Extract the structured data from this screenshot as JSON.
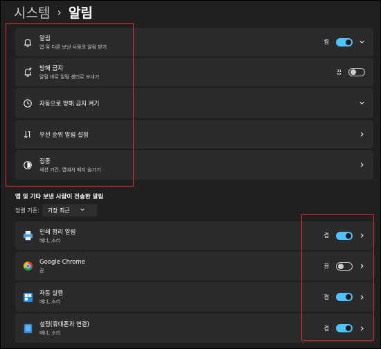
{
  "breadcrumb": {
    "parent": "시스템",
    "separator": "›",
    "current": "알림"
  },
  "settings": [
    {
      "title": "알림",
      "subtitle": "앱 및 다른 보낸 사람의 알림 받기",
      "state": "켬",
      "toggle": "on",
      "chevron": "down",
      "icon": "bell-icon"
    },
    {
      "title": "방해 금지",
      "subtitle": "알림 바로 알림 센터로 보내기",
      "state": "끔",
      "toggle": "off",
      "chevron": "",
      "icon": "bell-snooze-icon"
    },
    {
      "title": "자동으로 방해 금지 켜기",
      "subtitle": "",
      "state": "",
      "toggle": "",
      "chevron": "down",
      "icon": "clock-icon"
    },
    {
      "title": "우선 순위 알림 설정",
      "subtitle": "",
      "state": "",
      "toggle": "",
      "chevron": "right",
      "icon": "priority-sort-icon"
    },
    {
      "title": "집중",
      "subtitle": "세션 기간, 앱에서 배지 숨기기",
      "state": "",
      "toggle": "",
      "chevron": "right",
      "icon": "focus-icon"
    }
  ],
  "apps_section": {
    "title": "앱 및 기타 보낸 사람이 전송한 알림",
    "sort_label": "정렬 기준:",
    "sort_value": "가장 최근"
  },
  "apps": [
    {
      "title": "인쇄 정리 알림",
      "subtitle": "배너, 소리",
      "state": "켬",
      "toggle": "on",
      "icon": "printer-app-icon"
    },
    {
      "title": "Google Chrome",
      "subtitle": "끔",
      "state": "끔",
      "toggle": "off",
      "icon": "chrome-app-icon"
    },
    {
      "title": "자동 실행",
      "subtitle": "배너, 소리",
      "state": "켬",
      "toggle": "on",
      "icon": "autoplay-app-icon"
    },
    {
      "title": "설정(휴대폰과 연결)",
      "subtitle": "배너, 소리",
      "state": "켬",
      "toggle": "on",
      "icon": "settings-phone-app-icon"
    }
  ],
  "colors": {
    "accent": "#4cc2ff",
    "background": "#202020",
    "card": "#2b2b2b",
    "highlight_box": "#e0262b"
  }
}
